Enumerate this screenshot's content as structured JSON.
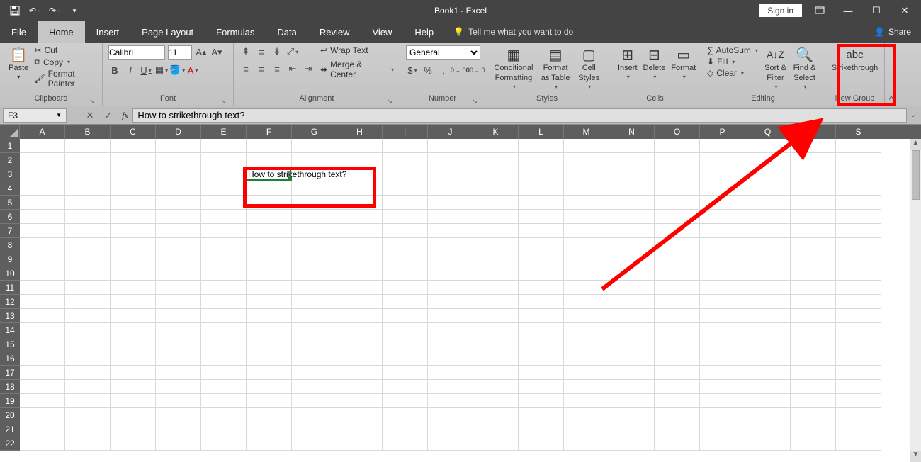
{
  "titlebar": {
    "title": "Book1  -  Excel",
    "signin": "Sign in"
  },
  "tabs": {
    "file": "File",
    "home": "Home",
    "insert": "Insert",
    "pagelayout": "Page Layout",
    "formulas": "Formulas",
    "data": "Data",
    "review": "Review",
    "view": "View",
    "help": "Help",
    "tellme": "Tell me what you want to do",
    "share": "Share"
  },
  "ribbon": {
    "clipboard": {
      "title": "Clipboard",
      "paste": "Paste",
      "cut": "Cut",
      "copy": "Copy",
      "formatpainter": "Format Painter"
    },
    "font": {
      "title": "Font",
      "fontname": "Calibri",
      "fontsize": "11"
    },
    "alignment": {
      "title": "Alignment",
      "wrap": "Wrap Text",
      "merge": "Merge & Center"
    },
    "number": {
      "title": "Number",
      "format": "General"
    },
    "styles": {
      "title": "Styles",
      "cond": "Conditional Formatting",
      "table": "Format as Table",
      "cell": "Cell Styles"
    },
    "cells": {
      "title": "Cells",
      "insert": "Insert",
      "delete": "Delete",
      "format": "Format"
    },
    "editing": {
      "title": "Editing",
      "autosum": "AutoSum",
      "fill": "Fill",
      "clear": "Clear",
      "sort": "Sort & Filter",
      "find": "Find & Select"
    },
    "newgroup": {
      "title": "New Group",
      "strike": "Strikethrough",
      "strike_icon": "abc"
    }
  },
  "formulabar": {
    "namebox": "F3",
    "formula": "How to strikethrough text?"
  },
  "grid": {
    "columns": [
      "A",
      "B",
      "C",
      "D",
      "E",
      "F",
      "G",
      "H",
      "I",
      "J",
      "K",
      "L",
      "M",
      "N",
      "O",
      "P",
      "Q",
      "R",
      "S"
    ],
    "rowcount": 22,
    "active_cell": "F3",
    "cells": {
      "F3": "How to strikethrough text?"
    }
  }
}
